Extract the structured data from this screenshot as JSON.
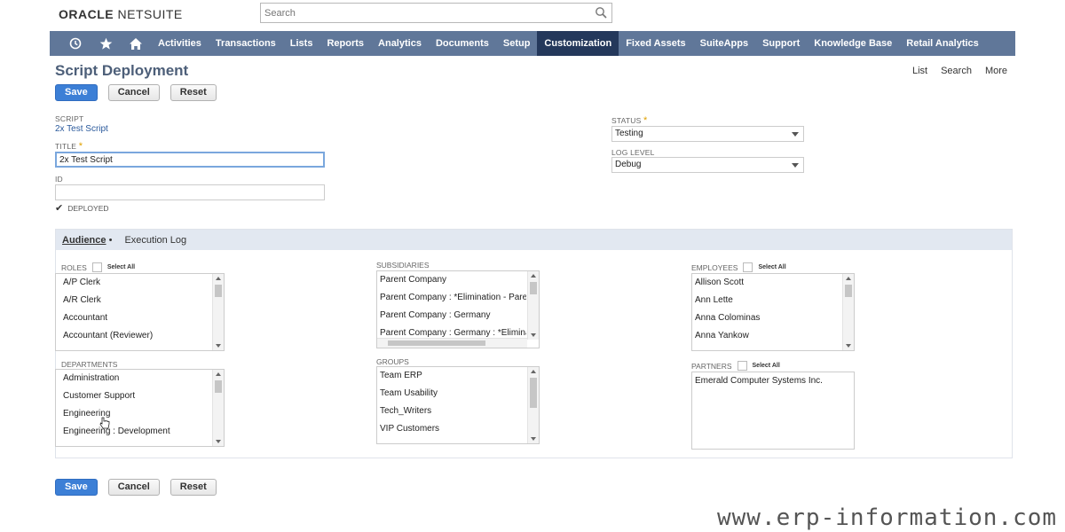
{
  "header": {
    "logo_bold": "ORACLE",
    "logo_light": "NETSUITE",
    "search_placeholder": "Search"
  },
  "nav": {
    "icons": [
      "recent-icon",
      "star-icon",
      "home-icon"
    ],
    "items": [
      "Activities",
      "Transactions",
      "Lists",
      "Reports",
      "Analytics",
      "Documents",
      "Setup",
      "Customization",
      "Fixed Assets",
      "SuiteApps",
      "Support",
      "Knowledge Base",
      "Retail Analytics"
    ],
    "active": "Customization"
  },
  "page": {
    "title": "Script Deployment",
    "links": [
      "List",
      "Search",
      "More"
    ]
  },
  "buttons": {
    "save": "Save",
    "cancel": "Cancel",
    "reset": "Reset"
  },
  "form": {
    "script_label": "SCRIPT",
    "script_value": "2x Test Script",
    "title_label": "TITLE",
    "title_value": "2x Test Script",
    "id_label": "ID",
    "id_value": "",
    "deployed_label": "DEPLOYED",
    "deployed_checked": true,
    "status_label": "STATUS",
    "status_value": "Testing",
    "log_level_label": "LOG LEVEL",
    "log_level_value": "Debug"
  },
  "tabs": {
    "audience": "Audience",
    "audience_marker": "•",
    "execution_log": "Execution Log"
  },
  "audience": {
    "select_all": "Select All",
    "roles": {
      "label": "ROLES",
      "items": [
        "A/P Clerk",
        "A/R Clerk",
        "Accountant",
        "Accountant (Reviewer)"
      ]
    },
    "departments": {
      "label": "DEPARTMENTS",
      "items": [
        "Administration",
        "Customer Support",
        "Engineering",
        "Engineering : Development"
      ]
    },
    "subsidiaries": {
      "label": "SUBSIDIARIES",
      "items": [
        "Parent Company",
        "Parent Company : *Elimination - Paren",
        "Parent Company : Germany",
        "Parent Company : Germany : *Eliminat"
      ]
    },
    "groups": {
      "label": "GROUPS",
      "items": [
        "Team ERP",
        "Team Usability",
        "Tech_Writers",
        "VIP Customers"
      ]
    },
    "employees": {
      "label": "EMPLOYEES",
      "items": [
        "Allison Scott",
        "Ann Lette",
        "Anna Colominas",
        "Anna Yankow"
      ]
    },
    "partners": {
      "label": "PARTNERS",
      "items": [
        "Emerald Computer Systems Inc."
      ]
    }
  },
  "watermark": "www.erp-information.com",
  "colors": {
    "nav_bg": "#607799",
    "nav_active": "#24385b",
    "primary_button": "#3c7fd6",
    "title": "#4d5f79"
  }
}
